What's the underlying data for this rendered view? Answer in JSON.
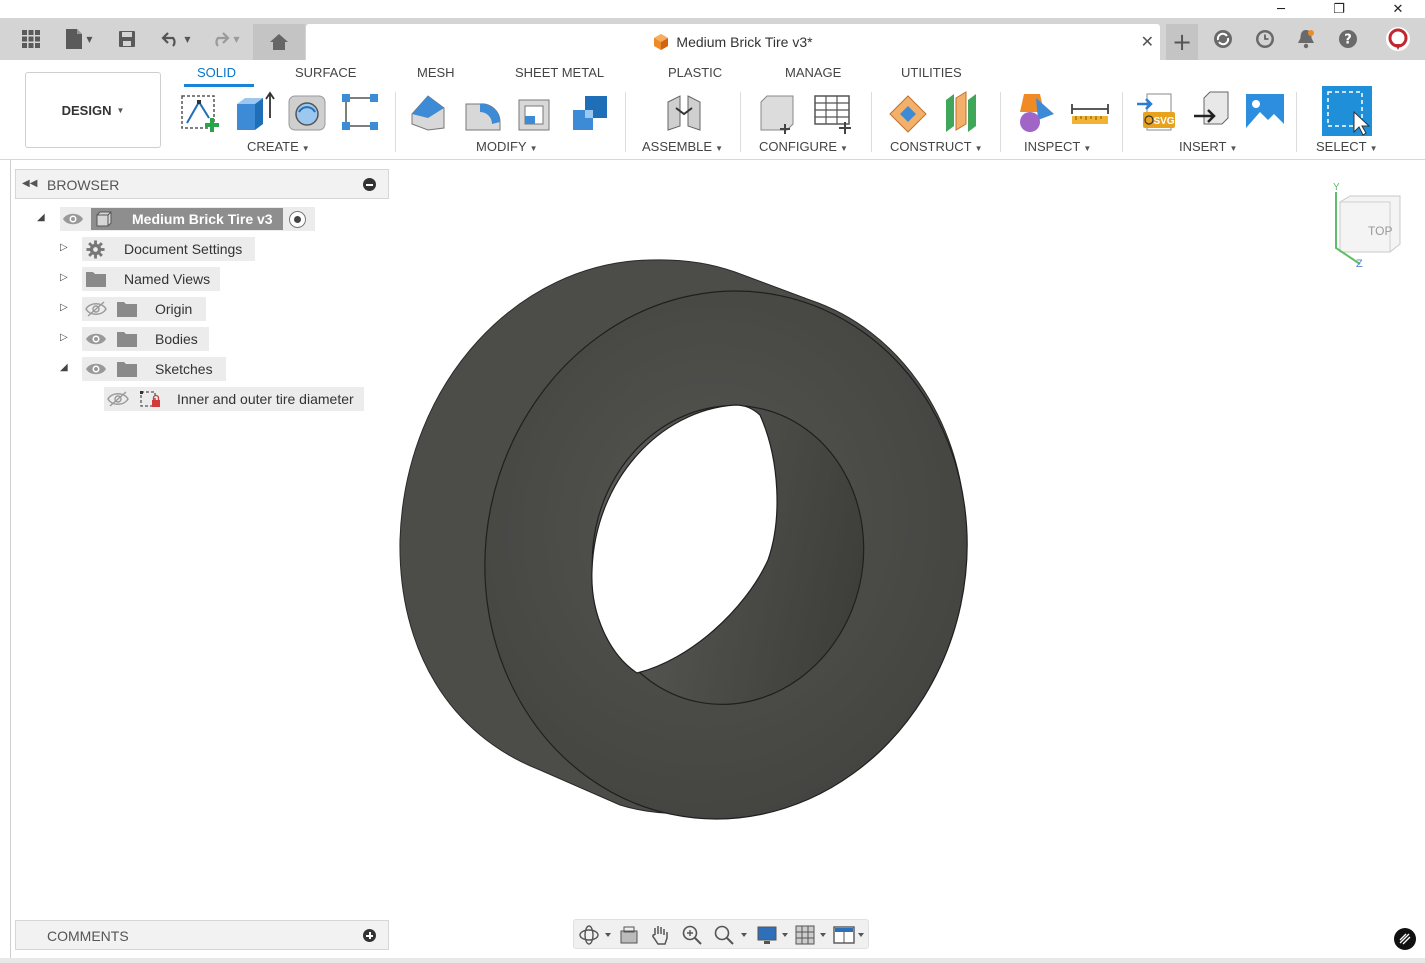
{
  "window": {
    "minimize_glyph": "─",
    "maximize_glyph": "❐",
    "close_glyph": "✕"
  },
  "tabbar": {
    "document_title": "Medium Brick Tire v3*",
    "close_tab_glyph": "✕",
    "new_tab_glyph": "+",
    "icons": [
      "apps-grid-icon",
      "file-icon",
      "save-icon",
      "undo-icon",
      "redo-icon",
      "home-icon",
      "add-tab-icon",
      "job-status-icon",
      "clock-icon",
      "bell-icon",
      "help-icon",
      "user-avatar"
    ]
  },
  "toolbar": {
    "workspace_label": "DESIGN",
    "tabs": [
      {
        "label": "SOLID",
        "active": true
      },
      {
        "label": "SURFACE",
        "active": false
      },
      {
        "label": "MESH",
        "active": false
      },
      {
        "label": "SHEET METAL",
        "active": false
      },
      {
        "label": "PLASTIC",
        "active": false
      },
      {
        "label": "MANAGE",
        "active": false
      },
      {
        "label": "UTILITIES",
        "active": false
      }
    ],
    "groups": {
      "create": "CREATE",
      "modify": "MODIFY",
      "assemble": "ASSEMBLE",
      "configure": "CONFIGURE",
      "construct": "CONSTRUCT",
      "inspect": "INSPECT",
      "insert": "INSERT",
      "select": "SELECT"
    },
    "accent_color": "#0a74c9"
  },
  "browser": {
    "title": "BROWSER",
    "root": "Medium Brick Tire v3",
    "items": [
      {
        "label": "Document Settings",
        "icon": "gear-icon"
      },
      {
        "label": "Named Views",
        "icon": "folder-icon"
      },
      {
        "label": "Origin",
        "icon": "folder-icon",
        "visible": false
      },
      {
        "label": "Bodies",
        "icon": "folder-icon",
        "visible": true
      },
      {
        "label": "Sketches",
        "icon": "folder-icon",
        "visible": true,
        "expanded": true
      }
    ],
    "sketch_item": "Inner and outer tire diameter"
  },
  "viewcube": {
    "face_label": "TOP",
    "axis_y": "Y",
    "axis_z": "Z"
  },
  "comments": {
    "title": "COMMENTS"
  },
  "model": {
    "fill_color": "#4a4a47"
  }
}
